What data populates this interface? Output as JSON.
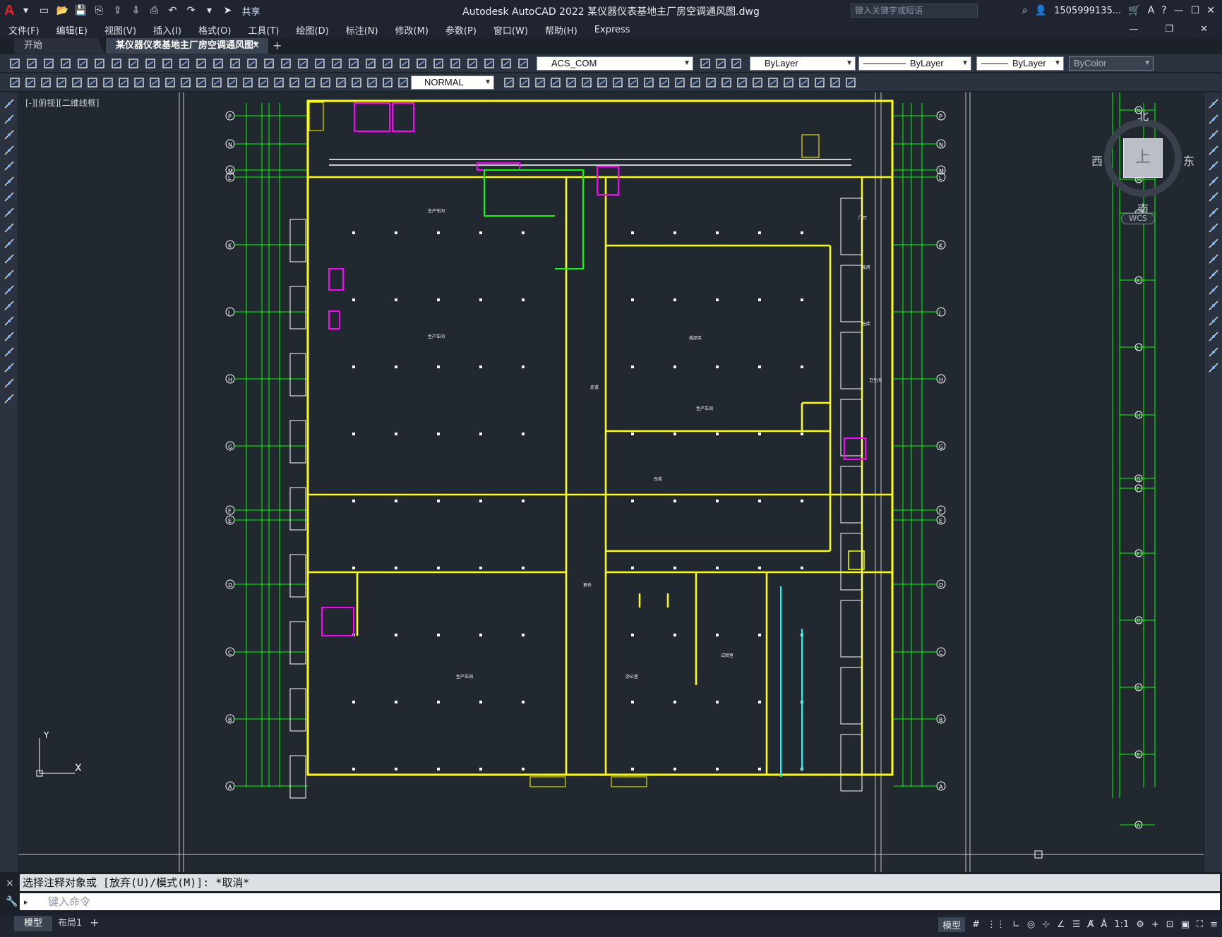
{
  "app": {
    "logo": "A",
    "title": "Autodesk AutoCAD 2022    某仪器仪表基地主厂房空调通风图.dwg",
    "share_label": "共享",
    "search_placeholder": "键入关键字或短语",
    "user": "1505999135...",
    "help": "?"
  },
  "menu": [
    "文件(F)",
    "编辑(E)",
    "视图(V)",
    "插入(I)",
    "格式(O)",
    "工具(T)",
    "绘图(D)",
    "标注(N)",
    "修改(M)",
    "参数(P)",
    "窗口(W)",
    "帮助(H)",
    "Express"
  ],
  "tabs": {
    "start": "开始",
    "active": "某仪器仪表基地主厂房空调通风图*",
    "close": "×",
    "add": "+"
  },
  "toolbar1": {
    "layer": "ACS_COM",
    "color": "ByLayer",
    "linetype": "ByLayer",
    "lineweight": "ByLayer",
    "plotstyle": "ByColor"
  },
  "toolbar2": {
    "textstyle": "NORMAL"
  },
  "viewport": {
    "label": "[-][俯视][二维线框]",
    "viewcube": {
      "top": "上",
      "north": "北",
      "south": "南",
      "east": "东",
      "west": "西"
    },
    "wcs": "WCS",
    "ucs_x": "X",
    "ucs_y": "Y"
  },
  "command": {
    "history": "选择注释对象或 [放弃(U)/模式(M)]: *取消*",
    "placeholder": "键入命令",
    "close": "×",
    "prompt": "▸"
  },
  "status": {
    "model_tab": "模型",
    "layout_tab": "布局1",
    "add": "+",
    "model_button": "模型",
    "scale": "1:1"
  },
  "drawing": {
    "grid_rows_left": [
      "P",
      "N",
      "M",
      "L",
      "K",
      "J",
      "H",
      "G",
      "F",
      "E",
      "D",
      "C",
      "B",
      "A"
    ],
    "grid_rows_right": [
      "P",
      "N",
      "M",
      "L",
      "K",
      "J",
      "H",
      "G",
      "F",
      "E",
      "D",
      "C",
      "B",
      "A"
    ],
    "grid_rows_far": [
      "N",
      "M",
      "L",
      "K",
      "J",
      "H",
      "G",
      "F",
      "E",
      "D",
      "C",
      "B",
      "A"
    ],
    "room_labels": [
      "生产车间",
      "生产车间",
      "生产车间",
      "成品库",
      "仓库",
      "生产车间",
      "试验室",
      "办公室",
      "仓库",
      "走道",
      "库房",
      "门厅",
      "更衣",
      "卫生间"
    ]
  }
}
